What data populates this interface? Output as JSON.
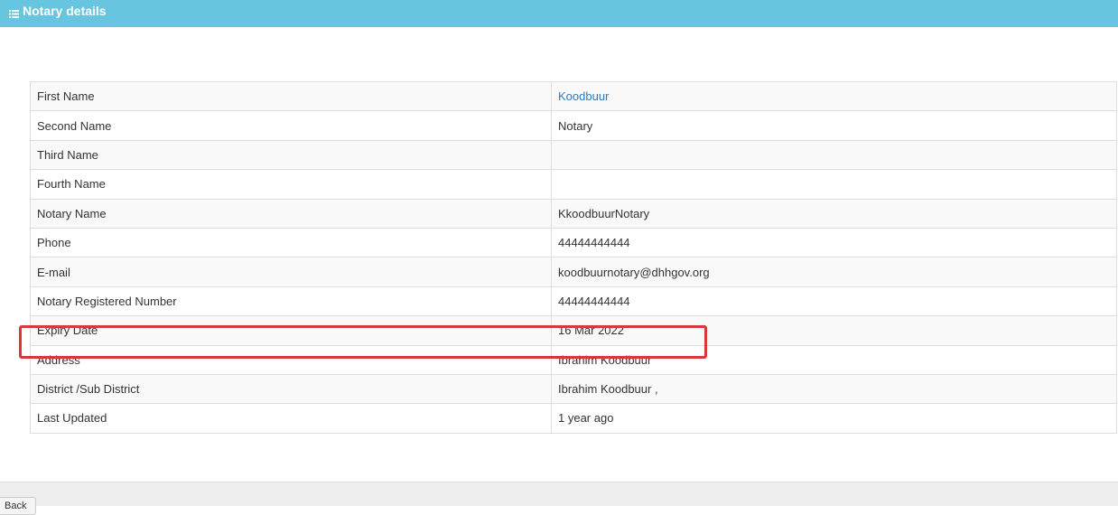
{
  "header": {
    "icon": "list-icon",
    "title": "Notary details",
    "background_color": "#67c5e0"
  },
  "details": [
    {
      "label": "First Name",
      "value": "Koodbuur",
      "is_link": true
    },
    {
      "label": "Second Name",
      "value": "Notary"
    },
    {
      "label": "Third Name",
      "value": ""
    },
    {
      "label": "Fourth Name",
      "value": ""
    },
    {
      "label": "Notary Name",
      "value": "KkoodbuurNotary"
    },
    {
      "label": "Phone",
      "value": "44444444444"
    },
    {
      "label": "E-mail",
      "value": "koodbuurnotary@dhhgov.org"
    },
    {
      "label": "Notary Registered Number",
      "value": "44444444444"
    },
    {
      "label": "Expiry Date",
      "value": "16 Mar 2022",
      "highlighted": true
    },
    {
      "label": "Address",
      "value": "Ibrahim Koodbuur"
    },
    {
      "label": "District /Sub District",
      "value": "Ibrahim Koodbuur ,"
    },
    {
      "label": "Last Updated",
      "value": "1 year ago"
    }
  ],
  "highlight_color": "#d9383a",
  "footer": {
    "back_button_label": "Back"
  }
}
